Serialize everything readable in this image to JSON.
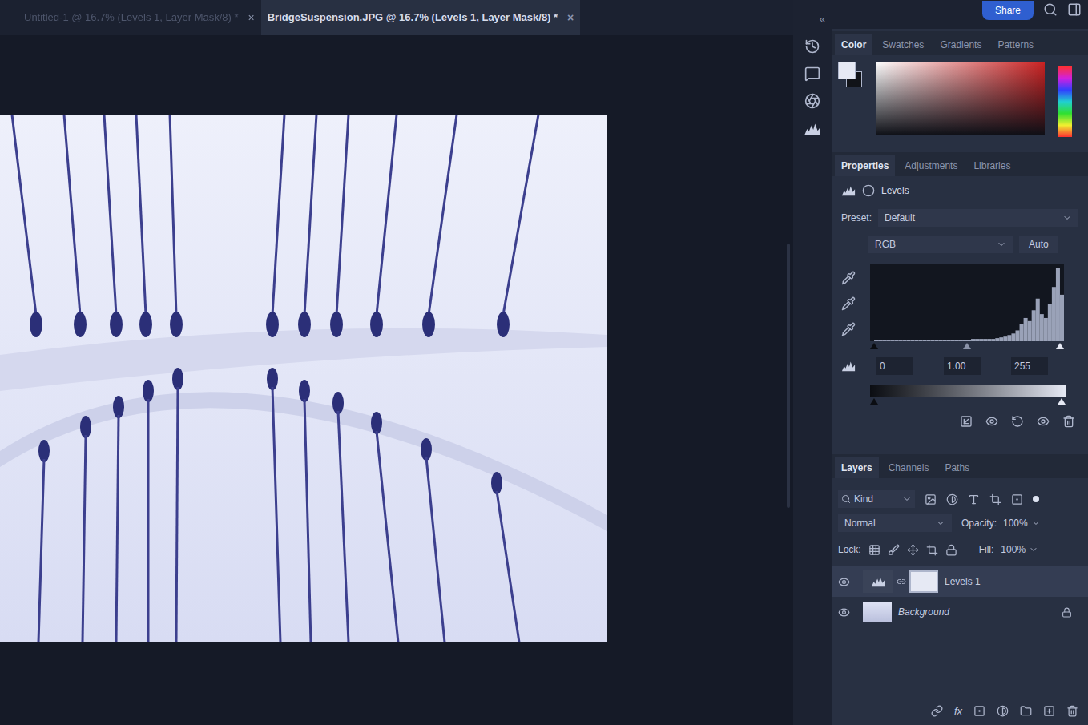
{
  "document_tabs": [
    {
      "label": "Untitled-1 @ 16.7% (Levels 1, Layer Mask/8) *",
      "selected": false,
      "close": "×"
    },
    {
      "label": "BridgeSuspension.JPG @ 16.7% (Levels 1, Layer Mask/8) *",
      "selected": true,
      "close": "×"
    }
  ],
  "collapse": "«",
  "share_button": "Share",
  "color_panel": {
    "tabs": [
      {
        "label": "Color",
        "selected": true
      },
      {
        "label": "Swatches",
        "selected": false
      },
      {
        "label": "Gradients",
        "selected": false
      },
      {
        "label": "Patterns",
        "selected": false
      }
    ]
  },
  "properties_panel": {
    "tabs": [
      {
        "label": "Properties",
        "selected": true
      },
      {
        "label": "Adjustments",
        "selected": false
      },
      {
        "label": "Libraries",
        "selected": false
      }
    ],
    "adjustment": "Levels",
    "preset_label": "Preset:",
    "preset": "Default",
    "channel": "RGB",
    "auto_button": "Auto",
    "histogram": [
      0,
      1,
      1,
      1,
      1,
      1,
      1,
      1,
      1,
      2,
      2,
      2,
      2,
      2,
      2,
      2,
      2,
      2,
      2,
      2,
      2,
      2,
      2,
      2,
      2,
      3,
      3,
      3,
      3,
      3,
      3,
      4,
      5,
      6,
      8,
      10,
      14,
      22,
      30,
      26,
      40,
      55,
      35,
      30,
      48,
      70,
      95,
      60
    ],
    "input_markers": [
      0,
      0.5,
      1
    ],
    "input_black": "0",
    "input_gamma": "1.00",
    "input_white": "255",
    "output_markers": [
      0,
      1
    ]
  },
  "layers_panel": {
    "tabs": [
      {
        "label": "Layers",
        "selected": true
      },
      {
        "label": "Channels",
        "selected": false
      },
      {
        "label": "Paths",
        "selected": false
      }
    ],
    "filter": "Kind",
    "blend_mode": "Normal",
    "opacity_label": "Opacity:",
    "opacity": "100%",
    "lock_label": "Lock:",
    "fill_label": "Fill:",
    "fill": "100%",
    "layers": [
      {
        "name": "Levels 1",
        "kind": "adjustment",
        "selected": true,
        "visible": true,
        "locked": false
      },
      {
        "name": "Background",
        "kind": "image",
        "selected": false,
        "visible": true,
        "locked": true
      }
    ],
    "footer_fx": "fx"
  }
}
